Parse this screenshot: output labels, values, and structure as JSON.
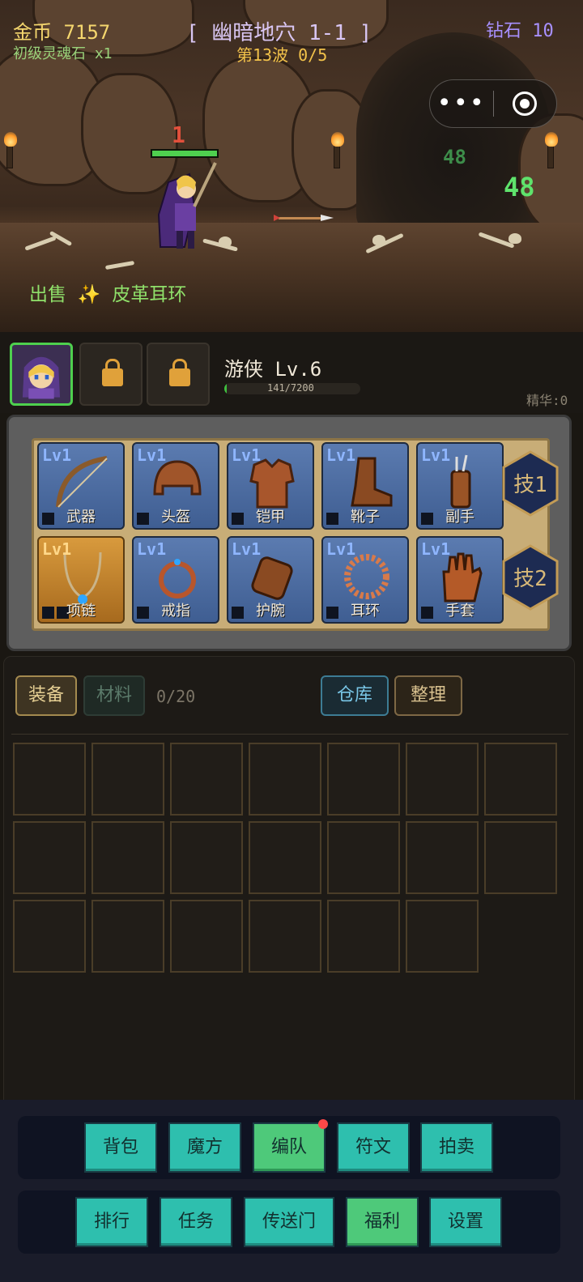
{
  "hud": {
    "gold": "金币 7157",
    "soul_stone": "初级灵魂石 x1",
    "stage": "[ 幽暗地穴 1-1 ]",
    "wave": "第13波 0/5",
    "diamond": "钻石 10",
    "damage_small": "48",
    "damage_big": "48",
    "hit_number": "1",
    "sold_prefix": "出售",
    "sold_spark": "✨",
    "sold_item": "皮革耳环",
    "hero_hp_fraction": 1.0
  },
  "miniprogram": {
    "more_icon": "more-dots-icon",
    "close_icon": "record-close-icon",
    "more_label": "•••"
  },
  "character": {
    "name": "游侠 Lv.6",
    "xp_text": "141/7200",
    "xp_fraction": 0.02,
    "essence": "精华:0",
    "slots": [
      "avatar",
      "locked",
      "locked"
    ]
  },
  "equipment": {
    "items": [
      {
        "level": "Lv1",
        "name": "武器",
        "icon": "bow-icon"
      },
      {
        "level": "Lv1",
        "name": "头盔",
        "icon": "helmet-icon"
      },
      {
        "level": "Lv1",
        "name": "铠甲",
        "icon": "armor-icon"
      },
      {
        "level": "Lv1",
        "name": "靴子",
        "icon": "boot-icon"
      },
      {
        "level": "Lv1",
        "name": "副手",
        "icon": "quiver-icon"
      },
      {
        "level": "Lv1",
        "name": "项链",
        "icon": "necklace-icon"
      },
      {
        "level": "Lv1",
        "name": "戒指",
        "icon": "ring-icon"
      },
      {
        "level": "Lv1",
        "name": "护腕",
        "icon": "bracer-icon"
      },
      {
        "level": "Lv1",
        "name": "耳环",
        "icon": "earring-icon"
      },
      {
        "level": "Lv1",
        "name": "手套",
        "icon": "glove-icon"
      }
    ],
    "skills": [
      "技1",
      "技2"
    ]
  },
  "inventory": {
    "tab_equip": "装备",
    "tab_material": "材料",
    "count": "0/20",
    "store_button": "仓库",
    "sort_button": "整理"
  },
  "nav": {
    "row1": [
      "背包",
      "魔方",
      "编队",
      "符文",
      "拍卖"
    ],
    "row2": [
      "排行",
      "任务",
      "传送门",
      "福利",
      "设置"
    ]
  },
  "colors": {
    "gold_text": "#f5d76e",
    "diamond_text": "#a890ff",
    "wave_text": "#f2c24a",
    "nav_teal": "#2ebfae",
    "nav_green": "#4ec97a",
    "active_slot_border": "#4ed04e"
  }
}
